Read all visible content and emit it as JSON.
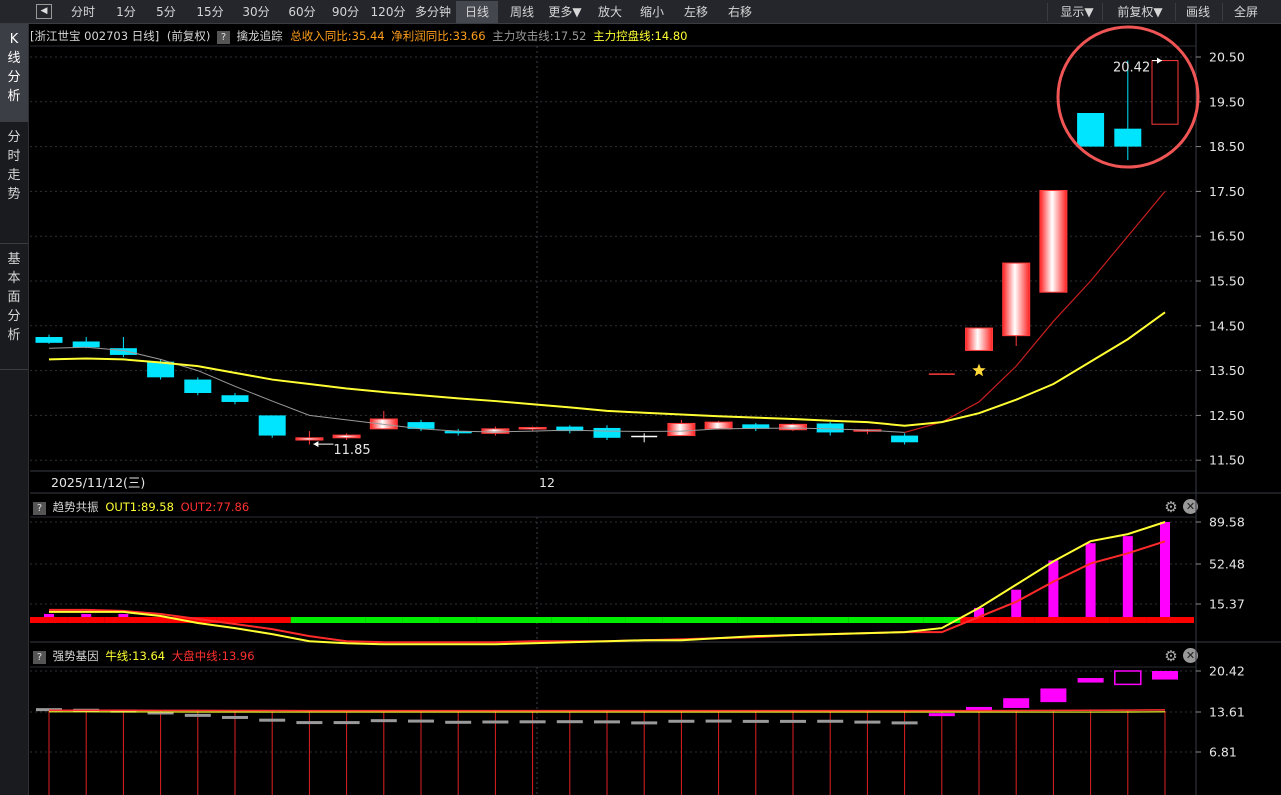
{
  "toolbar": {
    "back_icon": "◀",
    "buttons": [
      "分时",
      "1分",
      "5分",
      "15分",
      "30分",
      "60分",
      "90分",
      "120分",
      "多分钟",
      "日线",
      "周线",
      "更多▼",
      "放大",
      "缩小",
      "左移",
      "右移"
    ],
    "active": "日线",
    "right_buttons": [
      "显示▼",
      "前复权▼",
      "画线",
      "全屏"
    ]
  },
  "sidebar": [
    "K线分析",
    "分时走势",
    "基本面分析"
  ],
  "info": {
    "title": "[浙江世宝 002703 日线]",
    "adjust": "(前复权)",
    "q": "?",
    "indicator": "擒龙追踪",
    "rev_label": "总收入同比:35.44",
    "profit_label": "净利润同比:33.66",
    "attack_label": "主力攻击线:17.52",
    "control_label": "主力控盘线:14.80"
  },
  "ind1": {
    "name": "趋势共振",
    "out1": "OUT1:89.58",
    "out2": "OUT2:77.86"
  },
  "ind2": {
    "name": "强势基因",
    "bull": "牛线:13.64",
    "mkt": "大盘中线:13.96"
  },
  "colors": {
    "up": "#ff3b3b",
    "down": "#00e5ff",
    "yellow": "#ffff33",
    "magenta": "#ff00ff",
    "green": "#00ee00",
    "red": "#ff0000",
    "circle": "#f05555"
  },
  "chart_data": [
    {
      "type": "candlestick",
      "ylim": [
        11.3,
        20.8
      ],
      "yticks": [
        "20.50",
        "19.50",
        "18.50",
        "17.50",
        "16.50",
        "15.50",
        "14.50",
        "13.50",
        "12.50",
        "11.50"
      ],
      "date_label": "2025/11/12(三)",
      "x_tick": "12",
      "annotations": {
        "low": "11.85",
        "high": "20.42"
      },
      "candles": [
        [
          14.25,
          14.3,
          14.1,
          14.12
        ],
        [
          14.15,
          14.25,
          14.0,
          14.02
        ],
        [
          14.0,
          14.25,
          13.8,
          13.85
        ],
        [
          13.7,
          13.75,
          13.3,
          13.35
        ],
        [
          13.3,
          13.35,
          12.95,
          13.0
        ],
        [
          12.95,
          13.0,
          12.75,
          12.8
        ],
        [
          12.5,
          12.5,
          12.0,
          12.05
        ],
        [
          11.95,
          12.15,
          11.85,
          12.0
        ],
        [
          12.0,
          12.1,
          11.95,
          12.06
        ],
        [
          12.2,
          12.6,
          12.2,
          12.42
        ],
        [
          12.35,
          12.4,
          12.15,
          12.2
        ],
        [
          12.15,
          12.2,
          12.05,
          12.1
        ],
        [
          12.1,
          12.25,
          12.05,
          12.2
        ],
        [
          12.2,
          12.25,
          12.15,
          12.23
        ],
        [
          12.25,
          12.28,
          12.1,
          12.15
        ],
        [
          12.22,
          12.28,
          11.95,
          12.0
        ],
        [
          12.05,
          12.1,
          11.9,
          12.03
        ],
        [
          12.05,
          12.4,
          12.05,
          12.32
        ],
        [
          12.2,
          12.38,
          12.18,
          12.35
        ],
        [
          12.3,
          12.33,
          12.15,
          12.2
        ],
        [
          12.18,
          12.32,
          12.15,
          12.3
        ],
        [
          12.32,
          12.35,
          12.05,
          12.12
        ],
        [
          12.15,
          12.2,
          12.08,
          12.18
        ],
        [
          12.05,
          12.1,
          11.85,
          11.9
        ],
        [
          13.4,
          13.45,
          13.35,
          13.42
        ],
        [
          13.95,
          14.45,
          13.95,
          14.45
        ],
        [
          14.28,
          15.9,
          14.05,
          15.9
        ],
        [
          15.25,
          17.52,
          15.25,
          17.52
        ],
        [
          19.25,
          19.25,
          18.5,
          18.5
        ],
        [
          18.9,
          20.42,
          18.2,
          18.5
        ],
        [
          19.0,
          20.42,
          19.0,
          20.42
        ]
      ],
      "star_index": 25,
      "ma_gray": [
        14.0,
        14.02,
        13.95,
        13.75,
        13.5,
        13.15,
        12.82,
        12.5,
        12.4,
        12.3,
        12.2,
        12.15,
        12.13,
        12.15,
        12.17,
        12.15,
        12.14,
        12.15,
        12.2,
        12.21,
        12.22,
        12.2,
        12.17,
        12.12,
        12.35,
        12.8,
        13.6,
        14.6,
        15.5,
        16.5,
        17.5
      ],
      "ma_yellow": [
        13.75,
        13.77,
        13.75,
        13.68,
        13.6,
        13.45,
        13.3,
        13.2,
        13.1,
        13.02,
        12.95,
        12.88,
        12.82,
        12.75,
        12.68,
        12.6,
        12.56,
        12.52,
        12.48,
        12.45,
        12.42,
        12.38,
        12.35,
        12.27,
        12.35,
        12.55,
        12.85,
        13.2,
        13.7,
        14.2,
        14.8
      ]
    },
    {
      "type": "bar+line",
      "ylim": [
        -35,
        100
      ],
      "yticks": [
        "89.58",
        "52.48",
        "15.37"
      ],
      "bars": [
        6,
        6,
        6,
        0,
        0,
        0,
        0,
        0,
        0,
        0,
        0,
        0,
        0,
        0,
        0,
        0,
        0,
        0,
        0,
        0,
        0,
        0,
        0,
        0,
        0,
        12,
        30,
        59,
        76,
        83,
        97
      ],
      "flag_colors": [
        "red",
        "red",
        "red",
        "red",
        "red",
        "red",
        "red",
        "green",
        "green",
        "green",
        "green",
        "green",
        "green",
        "green",
        "green",
        "green",
        "green",
        "green",
        "green",
        "green",
        "green",
        "green",
        "green",
        "green",
        "green",
        "red",
        "red",
        "red",
        "red",
        "red",
        "red"
      ],
      "out1": [
        8,
        8,
        8,
        4,
        -3,
        -8,
        -14,
        -21,
        -23,
        -24,
        -24,
        -24,
        -24,
        -23,
        -22,
        -21,
        -20,
        -20,
        -18,
        -16,
        -15,
        -14,
        -13,
        -12,
        -8,
        12,
        35,
        58,
        78,
        85,
        97
      ],
      "out2": [
        10,
        10,
        9,
        6,
        1,
        -4,
        -9,
        -16,
        -21,
        -22,
        -22,
        -22,
        -22,
        -21,
        -21,
        -21,
        -20,
        -19,
        -18,
        -17,
        -15,
        -14,
        -13,
        -12,
        -12,
        3,
        18,
        38,
        56,
        66,
        77.86
      ]
    },
    {
      "type": "bar+line",
      "ylim": [
        0,
        23
      ],
      "yticks": [
        "20.42",
        "13.61",
        "6.81"
      ],
      "candles": [
        [
          14.25,
          14.12
        ],
        [
          14.15,
          14.02
        ],
        [
          14.0,
          13.85
        ],
        [
          13.7,
          13.35
        ],
        [
          13.3,
          13.0
        ],
        [
          12.95,
          12.8
        ],
        [
          12.5,
          12.05
        ],
        [
          12.1,
          11.95
        ],
        [
          12.1,
          11.95
        ],
        [
          12.42,
          12.2
        ],
        [
          12.35,
          12.2
        ],
        [
          12.15,
          12.1
        ],
        [
          12.2,
          12.1
        ],
        [
          12.23,
          12.2
        ],
        [
          12.25,
          12.15
        ],
        [
          12.22,
          12.0
        ],
        [
          12.05,
          12.03
        ],
        [
          12.32,
          12.05
        ],
        [
          12.35,
          12.2
        ],
        [
          12.3,
          12.2
        ],
        [
          12.3,
          12.18
        ],
        [
          12.32,
          12.12
        ],
        [
          12.18,
          12.15
        ],
        [
          12.05,
          11.9
        ],
        [
          13.42,
          13.4
        ],
        [
          14.45,
          13.95
        ],
        [
          15.9,
          14.28
        ],
        [
          17.52,
          15.25
        ],
        [
          19.25,
          18.5
        ],
        [
          20.42,
          18.2
        ],
        [
          20.42,
          19.0
        ]
      ],
      "bull_line": [
        13.64,
        13.64,
        13.63,
        13.62,
        13.61,
        13.61,
        13.6,
        13.6,
        13.6,
        13.6,
        13.6,
        13.6,
        13.6,
        13.6,
        13.6,
        13.6,
        13.6,
        13.6,
        13.6,
        13.6,
        13.6,
        13.6,
        13.6,
        13.6,
        13.6,
        13.6,
        13.6,
        13.6,
        13.6,
        13.61,
        13.64
      ],
      "mkt_line": [
        13.9,
        13.9,
        13.9,
        13.88,
        13.87,
        13.85,
        13.85,
        13.84,
        13.84,
        13.84,
        13.84,
        13.84,
        13.84,
        13.84,
        13.84,
        13.84,
        13.84,
        13.84,
        13.84,
        13.84,
        13.84,
        13.84,
        13.84,
        13.84,
        13.84,
        13.84,
        13.86,
        13.88,
        13.9,
        13.93,
        13.96
      ]
    }
  ]
}
